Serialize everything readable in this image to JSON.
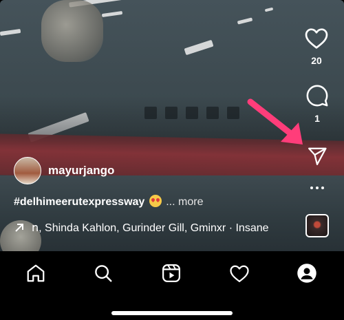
{
  "app": "Instagram Reels",
  "post": {
    "username": "mayurjango",
    "caption": "#delhimeerutexpressway",
    "caption_emoji": "heart-eyes-emoji",
    "more_label": "... more",
    "audio_text": "ո, Shinda Kahlon, Gurinder Gill, Gminxr · Insane"
  },
  "actions": {
    "like_count": "20",
    "comment_count": "1"
  },
  "annotation": {
    "arrow_color": "#ff3d7a"
  },
  "colors": {
    "nav_bg": "#000000",
    "icon": "#ffffff"
  },
  "nav": {
    "items": [
      "home-icon",
      "search-icon",
      "reels-icon",
      "heart-icon",
      "profile-icon"
    ]
  }
}
